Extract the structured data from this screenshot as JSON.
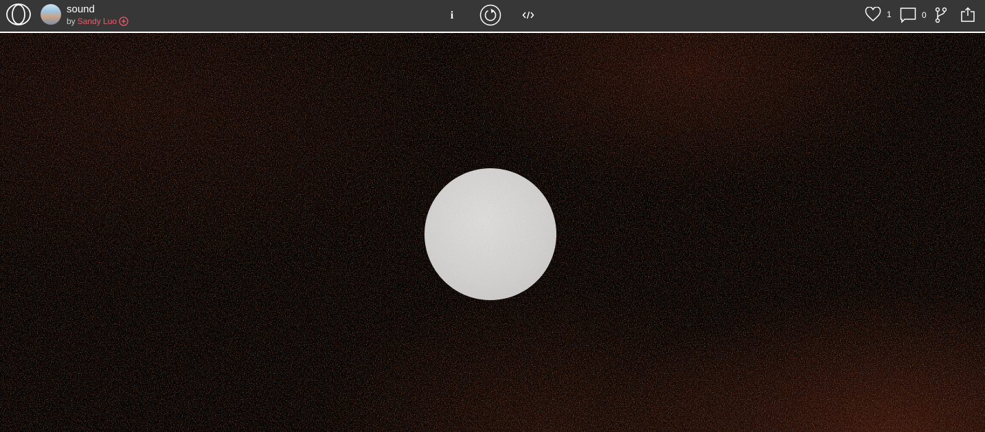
{
  "header": {
    "sketch_title": "sound",
    "by_prefix": "by",
    "author": "Sandy Luo",
    "icons": {
      "logo": "openprocessing-logo-icon",
      "follow": "plus-circle-icon",
      "info": "info-icon",
      "restart": "restart-icon",
      "code": "code-icon",
      "like": "heart-icon",
      "comment": "comment-icon",
      "fork": "fork-icon",
      "share": "share-icon"
    },
    "info_label": "i",
    "likes_count": "1",
    "comments_count": "0"
  },
  "colors": {
    "topbar": "#373737",
    "author": "#ee5a6b",
    "canvas": "#050302",
    "orb": "#d8d6d5"
  }
}
